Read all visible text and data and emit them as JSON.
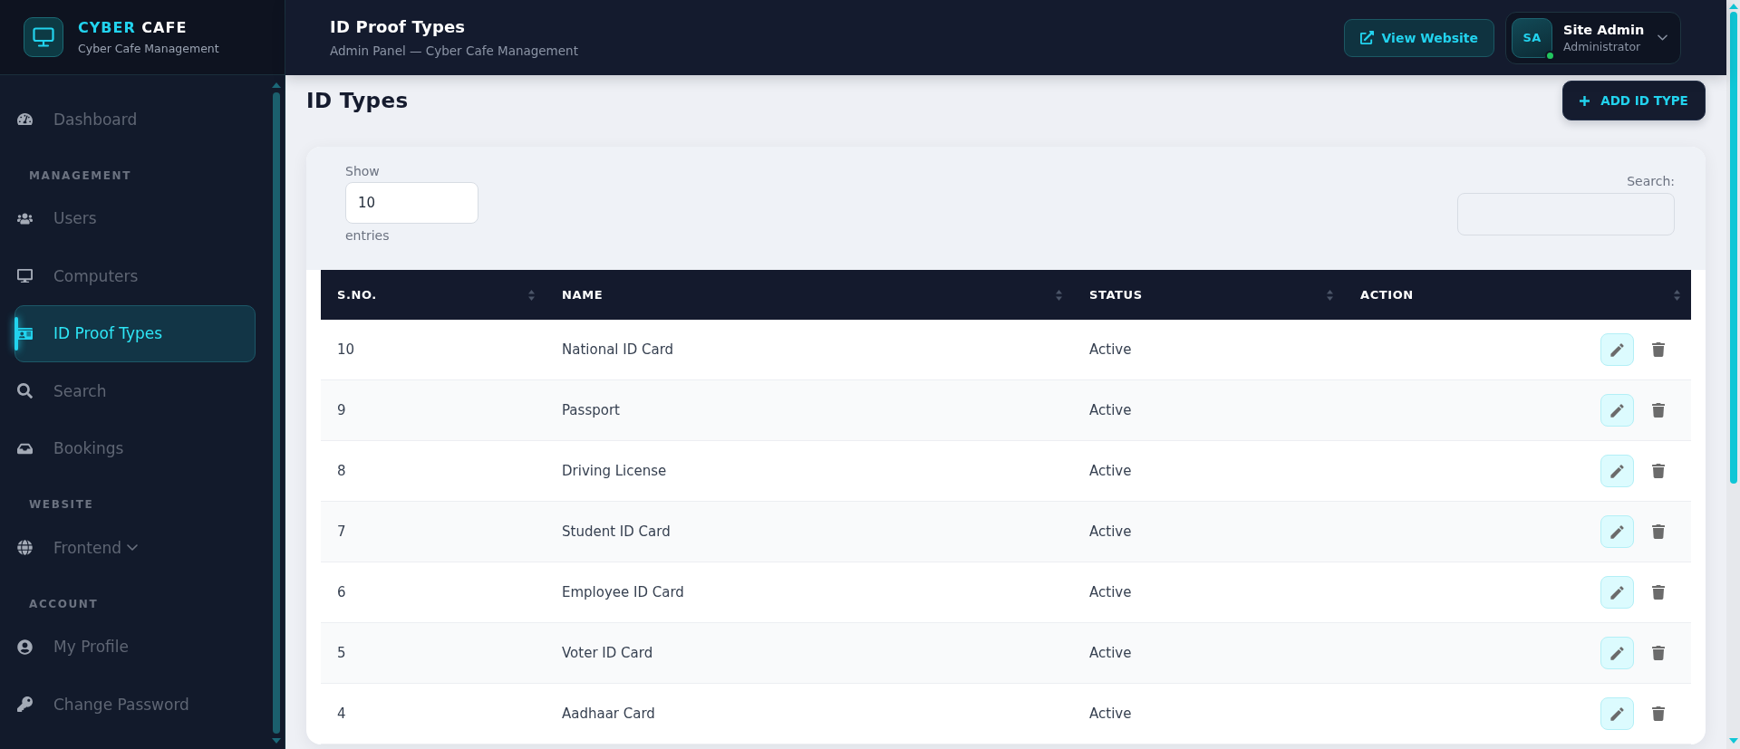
{
  "brand": {
    "accent": "CYBER",
    "name": "CAFE",
    "tagline": "Cyber Cafe Management"
  },
  "sidebar": {
    "groups": [
      {
        "items": [
          {
            "label": "Dashboard",
            "kind": "link",
            "selected": false
          }
        ]
      },
      {
        "heading": "MANAGEMENT",
        "items": [
          {
            "label": "Users",
            "kind": "link",
            "selected": false
          },
          {
            "label": "Computers",
            "kind": "link",
            "selected": false
          },
          {
            "label": "ID Proof Types",
            "kind": "link",
            "selected": true
          },
          {
            "label": "Search",
            "kind": "link",
            "selected": false
          },
          {
            "label": "Bookings",
            "kind": "link",
            "selected": false
          }
        ]
      },
      {
        "heading": "WEBSITE",
        "items": [
          {
            "label": "Frontend",
            "kind": "submenu",
            "selected": false
          }
        ]
      },
      {
        "heading": "ACCOUNT",
        "items": [
          {
            "label": "My Profile",
            "kind": "link",
            "selected": false
          },
          {
            "label": "Change Password",
            "kind": "link",
            "selected": false
          }
        ]
      }
    ]
  },
  "header": {
    "title": "ID Proof Types",
    "subtitle": "Admin Panel — Cyber Cafe Management",
    "view_website": "View Website",
    "user": {
      "initials": "SA",
      "name": "Site Admin",
      "role": "Administrator",
      "online": true
    }
  },
  "page": {
    "heading": "ID Types",
    "add_button": "ADD ID TYPE"
  },
  "table": {
    "length_label": "Show",
    "length_value": "10",
    "length_suffix": "entries",
    "search_label": "Search:",
    "columns": [
      "S.NO.",
      "NAME",
      "STATUS",
      "ACTION"
    ],
    "rows": [
      {
        "sno": "10",
        "name": "National ID Card",
        "status": "Active"
      },
      {
        "sno": "9",
        "name": "Passport",
        "status": "Active"
      },
      {
        "sno": "8",
        "name": "Driving License",
        "status": "Active"
      },
      {
        "sno": "7",
        "name": "Student ID Card",
        "status": "Active"
      },
      {
        "sno": "6",
        "name": "Employee ID Card",
        "status": "Active"
      },
      {
        "sno": "5",
        "name": "Voter ID Card",
        "status": "Active"
      },
      {
        "sno": "4",
        "name": "Aadhaar Card",
        "status": "Active"
      }
    ]
  }
}
